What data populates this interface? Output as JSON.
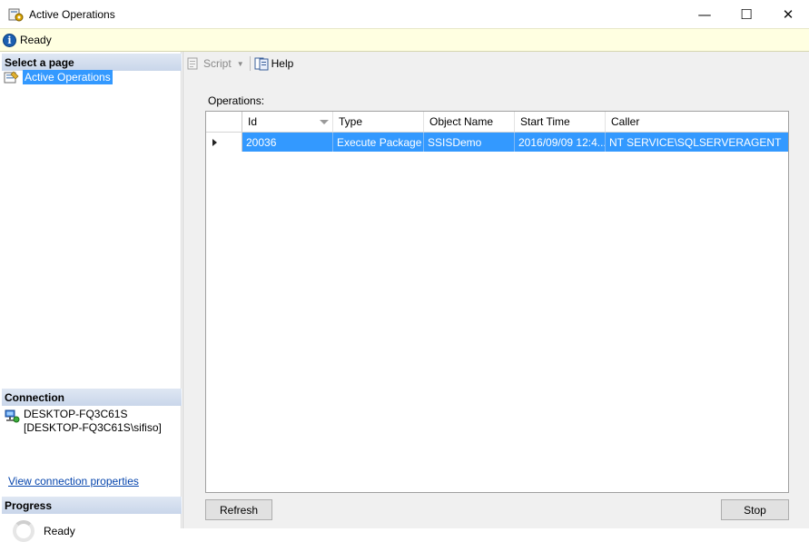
{
  "window": {
    "title": "Active Operations",
    "controls": {
      "minimize": "—",
      "maximize": "☐",
      "close": "✕"
    }
  },
  "status": {
    "text": "Ready",
    "icon": "info-icon"
  },
  "left_pane": {
    "select_page_header": "Select a page",
    "pages": [
      {
        "label": "Active Operations",
        "icon": "page-settings-icon",
        "selected": true
      }
    ],
    "connection_header": "Connection",
    "connection": {
      "server": "DESKTOP-FQ3C61S",
      "login": "[DESKTOP-FQ3C61S\\sifiso]",
      "icon": "server-connection-icon"
    },
    "connection_link": "View connection properties",
    "progress_header": "Progress",
    "progress_status": "Ready"
  },
  "toolbar": {
    "script_label": "Script",
    "script_enabled": false,
    "help_label": "Help"
  },
  "operations": {
    "label": "Operations:",
    "columns": [
      "Id",
      "Type",
      "Object Name",
      "Start Time",
      "Caller"
    ],
    "sorted_column": "Id",
    "rows": [
      {
        "id": "20036",
        "type": "Execute Package",
        "object_name": "SSISDemo",
        "start_time": "2016/09/09 12:4...",
        "caller": "NT SERVICE\\SQLSERVERAGENT",
        "selected": true
      }
    ]
  },
  "buttons": {
    "refresh": "Refresh",
    "stop": "Stop"
  },
  "colors": {
    "selection": "#3399ff",
    "status_bg": "#ffffe1",
    "section_header": "#c9d6ea",
    "link": "#0645ad"
  }
}
